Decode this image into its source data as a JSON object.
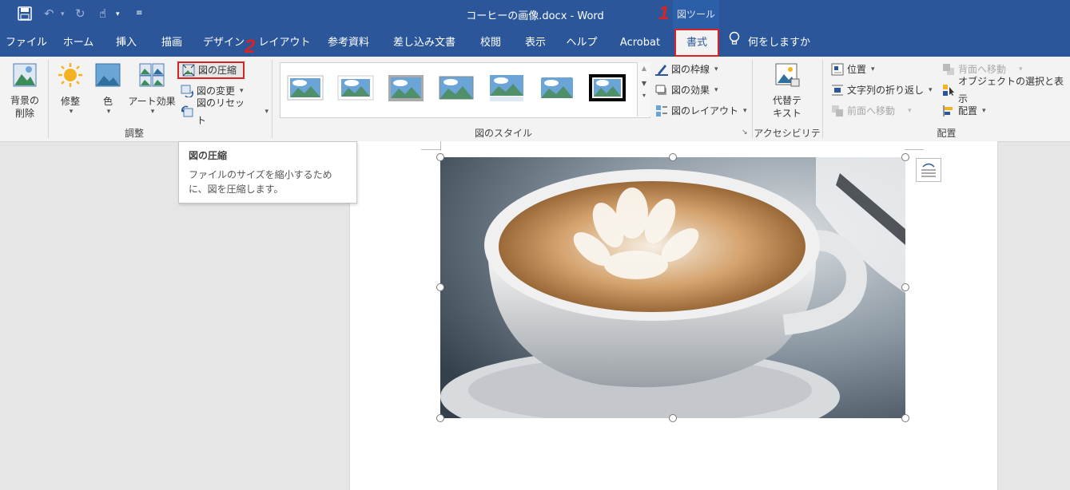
{
  "window": {
    "doc_title": "コーヒーの画像.docx  -  Word",
    "context_tab_group": "図ツール"
  },
  "tabs": [
    {
      "label": "ファイル"
    },
    {
      "label": "ホーム"
    },
    {
      "label": "挿入"
    },
    {
      "label": "描画"
    },
    {
      "label": "デザイン"
    },
    {
      "label": "レイアウト"
    },
    {
      "label": "参考資料"
    },
    {
      "label": "差し込み文書"
    },
    {
      "label": "校閲"
    },
    {
      "label": "表示"
    },
    {
      "label": "ヘルプ"
    },
    {
      "label": "Acrobat"
    },
    {
      "label": "書式"
    }
  ],
  "tell_me": "何をしますか",
  "ribbon": {
    "adjust": {
      "label": "調整",
      "remove_bg": "背景の\n削除",
      "corrections": "修整",
      "color": "色",
      "artistic": "アート効果",
      "compress": "図の圧縮",
      "change": "図の変更",
      "reset": "図のリセット"
    },
    "styles": {
      "label": "図のスタイル",
      "border": "図の枠線",
      "effects": "図の効果",
      "layout": "図のレイアウト"
    },
    "accessibility": {
      "label": "アクセシビリティ",
      "alt_text": "代替テ\nキスト"
    },
    "arrange": {
      "label": "配置",
      "position": "位置",
      "wrap_text": "文字列の折り返し",
      "bring_forward": "前面へ移動",
      "send_backward": "背面へ移動",
      "selection_pane": "オブジェクトの選択と表示",
      "align": "配置"
    }
  },
  "tooltip": {
    "title": "図の圧縮",
    "body": "ファイルのサイズを縮小するために、図を圧縮します。"
  },
  "badges": {
    "one": "1",
    "two": "2"
  },
  "colors": {
    "accent": "#2b579a",
    "highlight": "#d92323"
  }
}
